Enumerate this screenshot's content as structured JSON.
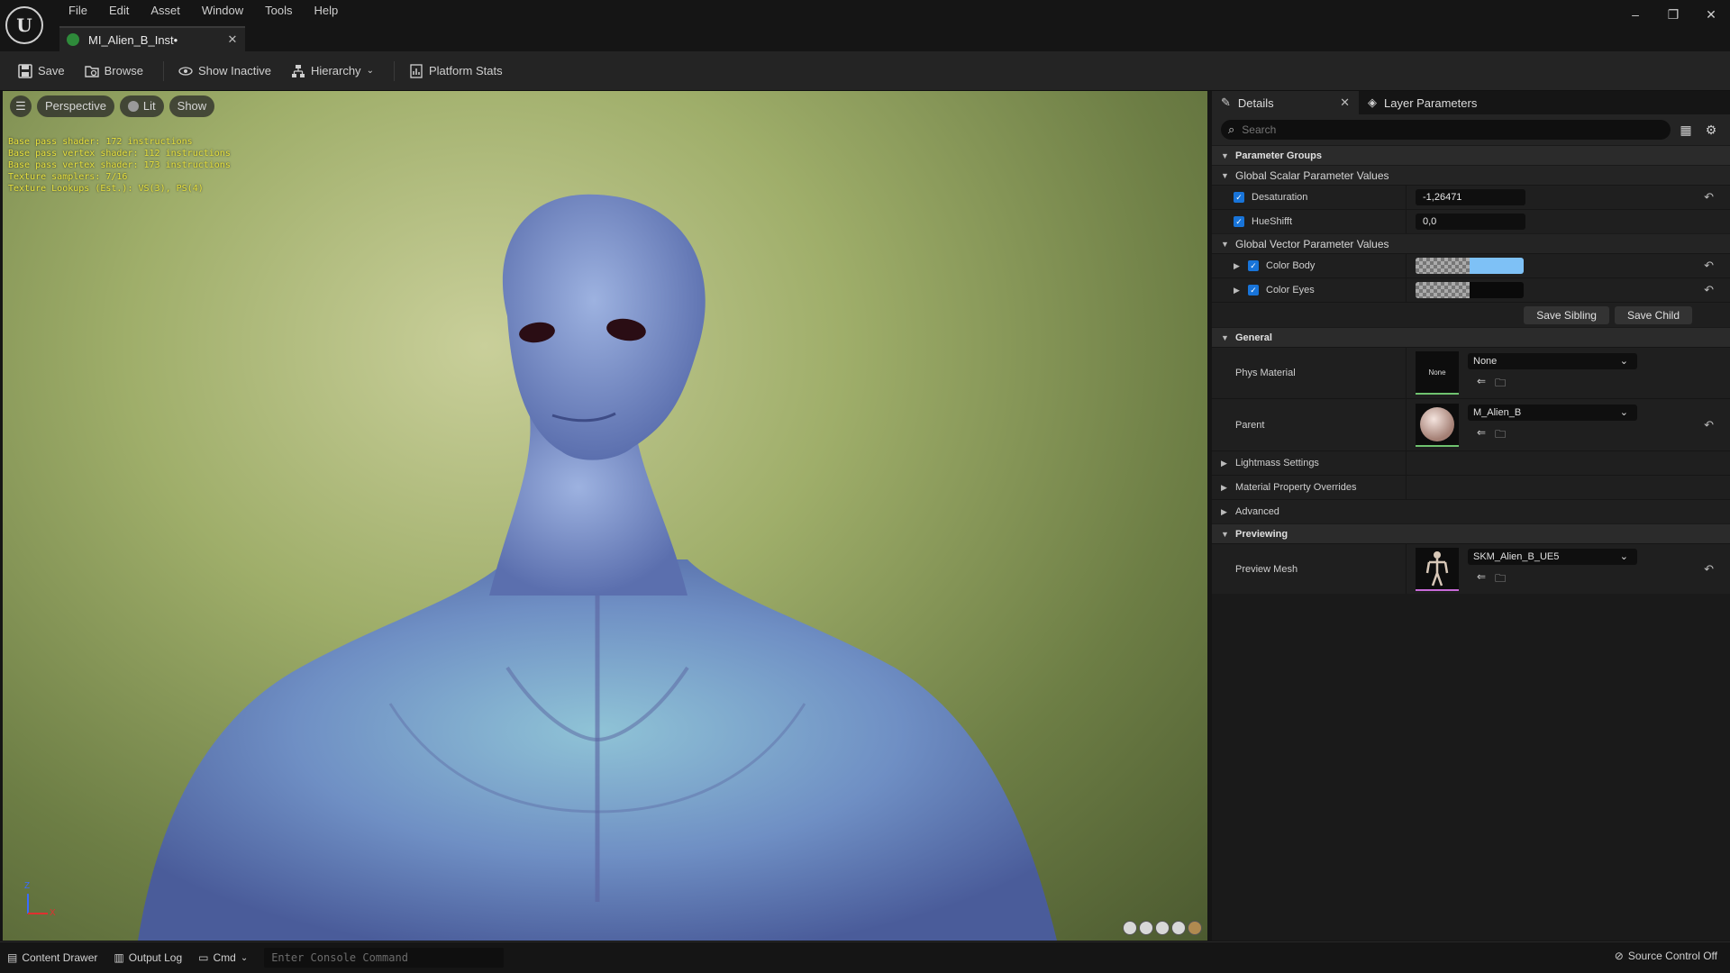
{
  "app": {
    "logo_text": "U",
    "menu": [
      "File",
      "Edit",
      "Asset",
      "Window",
      "Tools",
      "Help"
    ],
    "doc_tab": "MI_Alien_B_Inst•",
    "window_controls": [
      "–",
      "❐",
      "✕"
    ]
  },
  "toolbar": {
    "save": "Save",
    "browse": "Browse",
    "show_inactive": "Show Inactive",
    "hierarchy": "Hierarchy",
    "platform_stats": "Platform Stats"
  },
  "viewport": {
    "perspective": "Perspective",
    "lit": "Lit",
    "show": "Show",
    "stats": [
      "Base pass shader: 172 instructions",
      "Base pass vertex shader: 112 instructions",
      "Base pass vertex shader: 173 instructions",
      "Texture samplers: 7/16",
      "Texture Lookups (Est.): VS(3), PS(4)"
    ],
    "axis_z": "Z",
    "axis_x": "X"
  },
  "details": {
    "tab_details": "Details",
    "tab_layer": "Layer Parameters",
    "search_placeholder": "Search",
    "parameter_groups": "Parameter Groups",
    "global_scalar": "Global Scalar Parameter Values",
    "desaturation_label": "Desaturation",
    "desaturation_value": "-1,26471",
    "hueshift_label": "HueShifft",
    "hueshift_value": "0,0",
    "global_vector": "Global Vector Parameter Values",
    "color_body_label": "Color Body",
    "color_body_hex": "#7ec1f6",
    "color_eyes_label": "Color Eyes",
    "color_eyes_hex": "#0a0a0a",
    "save_sibling": "Save Sibling",
    "save_child": "Save Child",
    "general": "General",
    "phys_material_label": "Phys Material",
    "phys_material_thumb": "None",
    "phys_material_value": "None",
    "parent_label": "Parent",
    "parent_value": "M_Alien_B",
    "lightmass": "Lightmass Settings",
    "material_overrides": "Material Property Overrides",
    "advanced": "Advanced",
    "previewing": "Previewing",
    "preview_mesh_label": "Preview Mesh",
    "preview_mesh_value": "SKM_Alien_B_UE5"
  },
  "statusbar": {
    "content_drawer": "Content Drawer",
    "output_log": "Output Log",
    "cmd": "Cmd",
    "console_placeholder": "Enter Console Command",
    "source_control": "Source Control Off"
  }
}
